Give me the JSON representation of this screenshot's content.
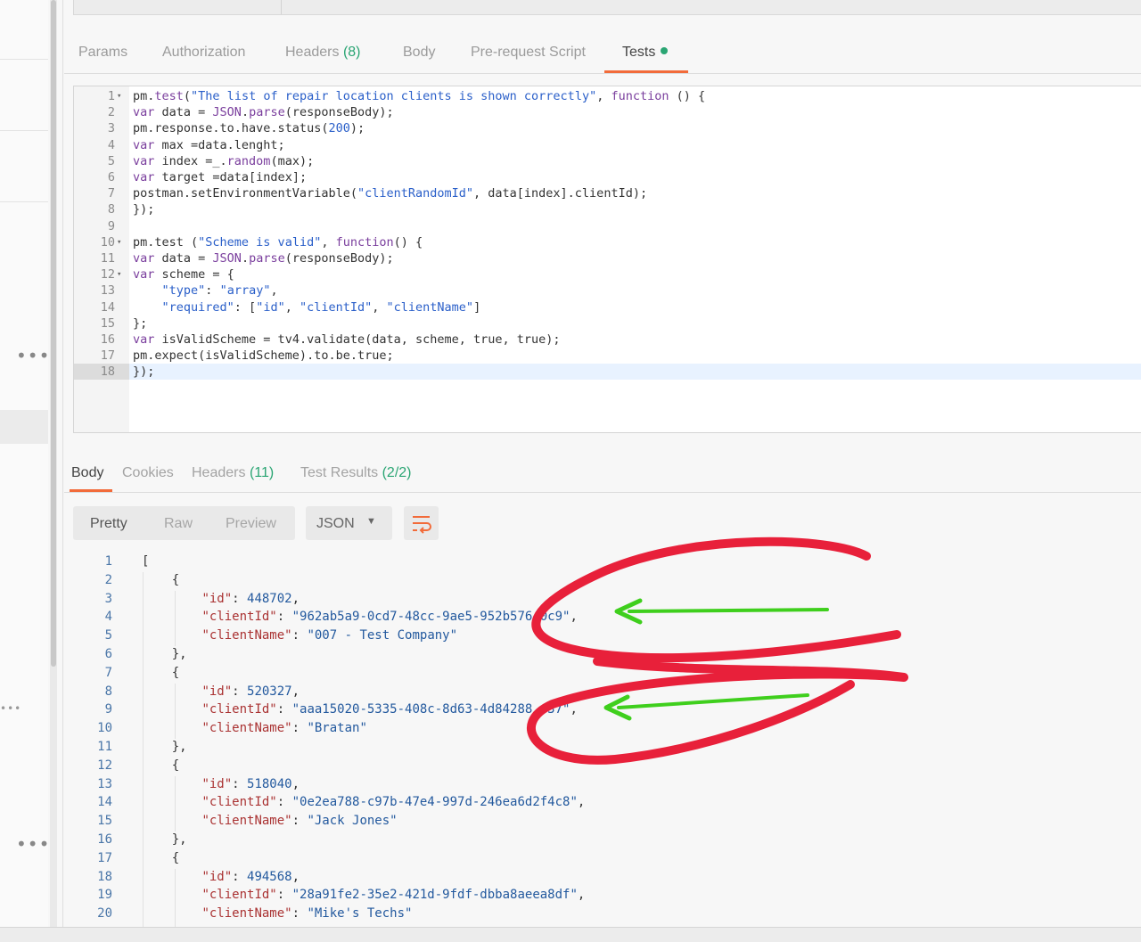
{
  "request_tabs": {
    "params": "Params",
    "authorization": "Authorization",
    "headers": "Headers",
    "headers_count": "(8)",
    "body": "Body",
    "prerequest": "Pre-request Script",
    "tests": "Tests"
  },
  "editor": {
    "lines": [
      {
        "n": "1",
        "fold": true,
        "html": "pm.<span class=\"f\">test</span>(<span class=\"s\">\"The list of repair location clients is shown correctly\"</span>, <span class=\"k\">function</span> () {"
      },
      {
        "n": "2",
        "html": "<span class=\"k\">var</span> data = <span class=\"f\">JSON</span>.<span class=\"f\">parse</span>(responseBody);"
      },
      {
        "n": "3",
        "html": "pm.response.to.have.status(<span class=\"n\">200</span>);"
      },
      {
        "n": "4",
        "html": "<span class=\"k\">var</span> max =data.lenght;"
      },
      {
        "n": "5",
        "html": "<span class=\"k\">var</span> index =_.<span class=\"f\">random</span>(max);"
      },
      {
        "n": "6",
        "html": "<span class=\"k\">var</span> target =data[index];"
      },
      {
        "n": "7",
        "html": "postman.setEnvironmentVariable(<span class=\"s\">\"clientRandomId\"</span>, data[index].clientId);"
      },
      {
        "n": "8",
        "html": "});"
      },
      {
        "n": "9",
        "html": ""
      },
      {
        "n": "10",
        "fold": true,
        "html": "pm.test (<span class=\"s\">\"Scheme is valid\"</span>, <span class=\"k\">function</span>() {"
      },
      {
        "n": "11",
        "html": "<span class=\"k\">var</span> data = <span class=\"f\">JSON</span>.<span class=\"f\">parse</span>(responseBody);"
      },
      {
        "n": "12",
        "fold": true,
        "html": "<span class=\"k\">var</span> scheme = {"
      },
      {
        "n": "13",
        "html": "    <span class=\"s\">\"type\"</span>: <span class=\"s\">\"array\"</span>,"
      },
      {
        "n": "14",
        "html": "    <span class=\"s\">\"required\"</span>: [<span class=\"s\">\"id\"</span>, <span class=\"s\">\"clientId\"</span>, <span class=\"s\">\"clientName\"</span>]"
      },
      {
        "n": "15",
        "html": "};"
      },
      {
        "n": "16",
        "html": "<span class=\"k\">var</span> isValidScheme = tv4.validate(data, scheme, true, true);"
      },
      {
        "n": "17",
        "html": "pm.expect(isValidScheme).to.be.true;"
      },
      {
        "n": "18",
        "html": "});"
      }
    ]
  },
  "response_tabs": {
    "body": "Body",
    "cookies": "Cookies",
    "headers": "Headers",
    "headers_count": "(11)",
    "test_results": "Test Results",
    "test_results_count": "(2/2)"
  },
  "view_toggle": {
    "pretty": "Pretty",
    "raw": "Raw",
    "preview": "Preview"
  },
  "format": {
    "selected": "JSON"
  },
  "response_json": {
    "lines": [
      {
        "n": "1",
        "html": "["
      },
      {
        "n": "2",
        "html": "    {"
      },
      {
        "n": "3",
        "html": "        <span class=\"jk\">\"id\"</span>: <span class=\"jn\">448702</span>,"
      },
      {
        "n": "4",
        "html": "        <span class=\"jk\">\"clientId\"</span>: <span class=\"js\">\"962ab5a9-0cd7-48cc-9ae5-952b5</span><span class=\"js\">7640c9\"</span>,"
      },
      {
        "n": "5",
        "html": "        <span class=\"jk\">\"clientName\"</span>: <span class=\"js\">\"007 - Test Company\"</span>"
      },
      {
        "n": "6",
        "html": "    },"
      },
      {
        "n": "7",
        "html": "    {"
      },
      {
        "n": "8",
        "html": "        <span class=\"jk\">\"id\"</span>: <span class=\"jn\">520327</span>,"
      },
      {
        "n": "9",
        "html": "        <span class=\"jk\">\"clientId\"</span>: <span class=\"js\">\"aaa15020-5335-408c-8d63-4d84288</span><span class=\"js\">  37\"</span>,"
      },
      {
        "n": "10",
        "html": "        <span class=\"jk\">\"clientName\"</span>: <span class=\"js\">\"Bratan\"</span>"
      },
      {
        "n": "11",
        "html": "    },"
      },
      {
        "n": "12",
        "html": "    {"
      },
      {
        "n": "13",
        "html": "        <span class=\"jk\">\"id\"</span>: <span class=\"jn\">518040</span>,"
      },
      {
        "n": "14",
        "html": "        <span class=\"jk\">\"clientId\"</span>: <span class=\"js\">\"0e2ea788-c97b-47e4-997d-246ea6d2f4c8\"</span>,"
      },
      {
        "n": "15",
        "html": "        <span class=\"jk\">\"clientName\"</span>: <span class=\"js\">\"Jack Jones\"</span>"
      },
      {
        "n": "16",
        "html": "    },"
      },
      {
        "n": "17",
        "html": "    {"
      },
      {
        "n": "18",
        "html": "        <span class=\"jk\">\"id\"</span>: <span class=\"jn\">494568</span>,"
      },
      {
        "n": "19",
        "html": "        <span class=\"jk\">\"clientId\"</span>: <span class=\"js\">\"28a91fe2-35e2-421d-9fdf-dbba8aeea8df\"</span>,"
      },
      {
        "n": "20",
        "html": "        <span class=\"jk\">\"clientName\"</span>: <span class=\"js\">\"Mike's Techs\"</span>"
      }
    ]
  },
  "sidebar": {
    "more_icon": "ellipsis-icon"
  },
  "annotation": {
    "loop_color": "#e8203a",
    "arrow_color": "#3fcf1d"
  }
}
